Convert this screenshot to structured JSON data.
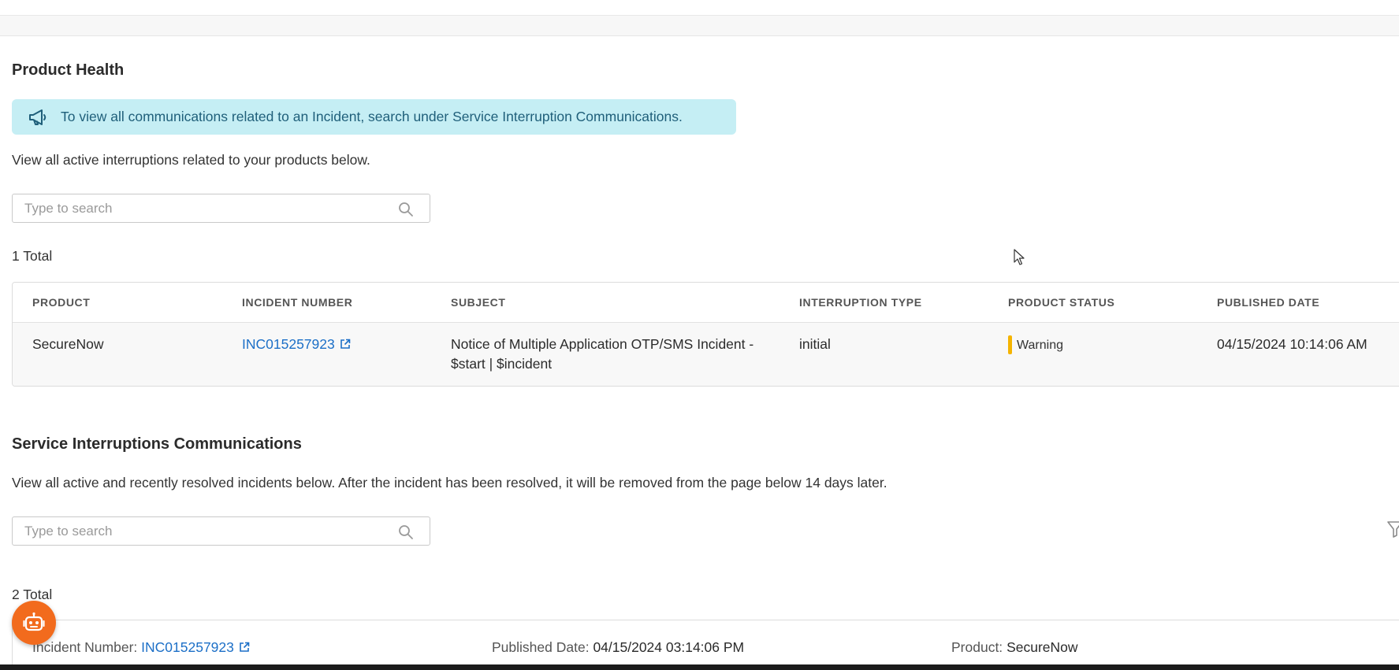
{
  "product_health": {
    "title": "Product Health",
    "banner_text": "To view all communications related to an Incident, search under Service Interruption Communications.",
    "description": "View all active interruptions related to your products below.",
    "search_placeholder": "Type to search",
    "total": "1 Total",
    "table": {
      "headers": [
        "PRODUCT",
        "INCIDENT NUMBER",
        "SUBJECT",
        "INTERRUPTION TYPE",
        "PRODUCT STATUS",
        "PUBLISHED DATE"
      ],
      "rows": [
        {
          "product": "SecureNow",
          "incident_number": "INC015257923",
          "subject": "Notice of Multiple Application OTP/SMS Incident - $start | $incident",
          "interruption_type": "initial",
          "product_status": "Warning",
          "published_date": "04/15/2024 10:14:06 AM"
        }
      ]
    }
  },
  "service_interruptions": {
    "title": "Service Interruptions Communications",
    "description": "View all active and recently resolved incidents below. After the incident has been resolved, it will be removed from the page below 14 days later.",
    "search_placeholder": "Type to search",
    "total": "2 Total",
    "cards": [
      {
        "incident_label": "Incident Number:",
        "incident_number": "INC015257923",
        "published_label": "Published Date:",
        "published_date": "04/15/2024 03:14:06 PM",
        "product_label": "Product:",
        "product": "SecureNow"
      }
    ]
  },
  "colors": {
    "banner_bg": "#c5eef4",
    "link": "#1c6fc7",
    "warning": "#f5b400",
    "bot_button": "#f26b1d"
  },
  "icons": {
    "banner": "megaphone-icon",
    "search": "search-icon",
    "external_link": "external-link-icon",
    "filter": "filter-icon",
    "chat_bot": "chat-bot-icon"
  }
}
